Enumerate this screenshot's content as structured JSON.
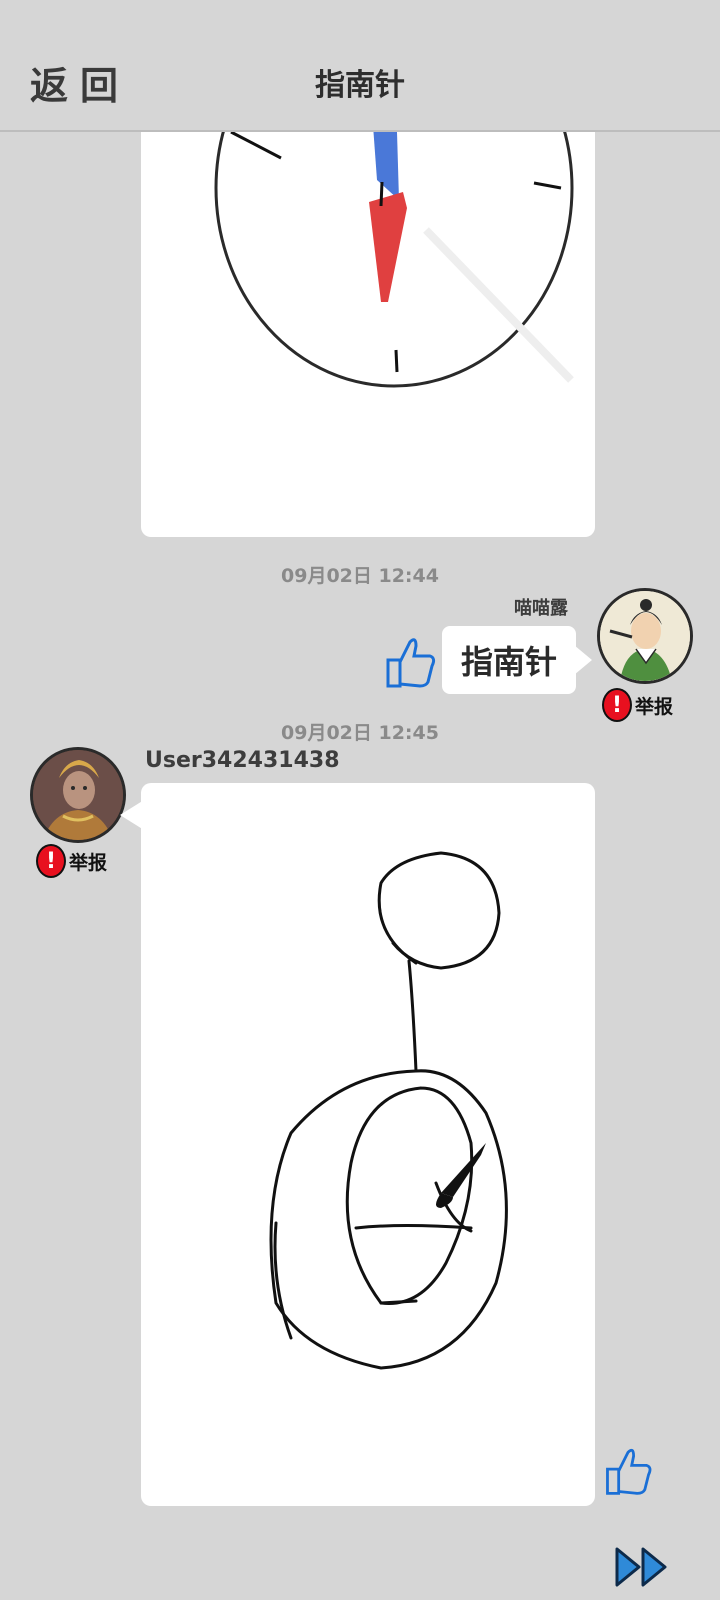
{
  "header": {
    "back_label": "返回",
    "title": "指南针"
  },
  "messages": [
    {
      "time": "09月02日  12:44",
      "sender": "喵喵露",
      "text": "指南针",
      "report_label": "举报"
    },
    {
      "time": "09月02日  12:45",
      "sender": "User342431438",
      "report_label": "举报"
    }
  ],
  "icons": {
    "like": "thumbs-up-icon",
    "report": "exclamation-icon",
    "next": "fast-forward-icon"
  },
  "colors": {
    "background": "#d6d6d6",
    "like_blue": "#1a6fd6",
    "report_red": "#e8101f",
    "compass_red": "#e04040",
    "compass_blue": "#4a78d8"
  }
}
